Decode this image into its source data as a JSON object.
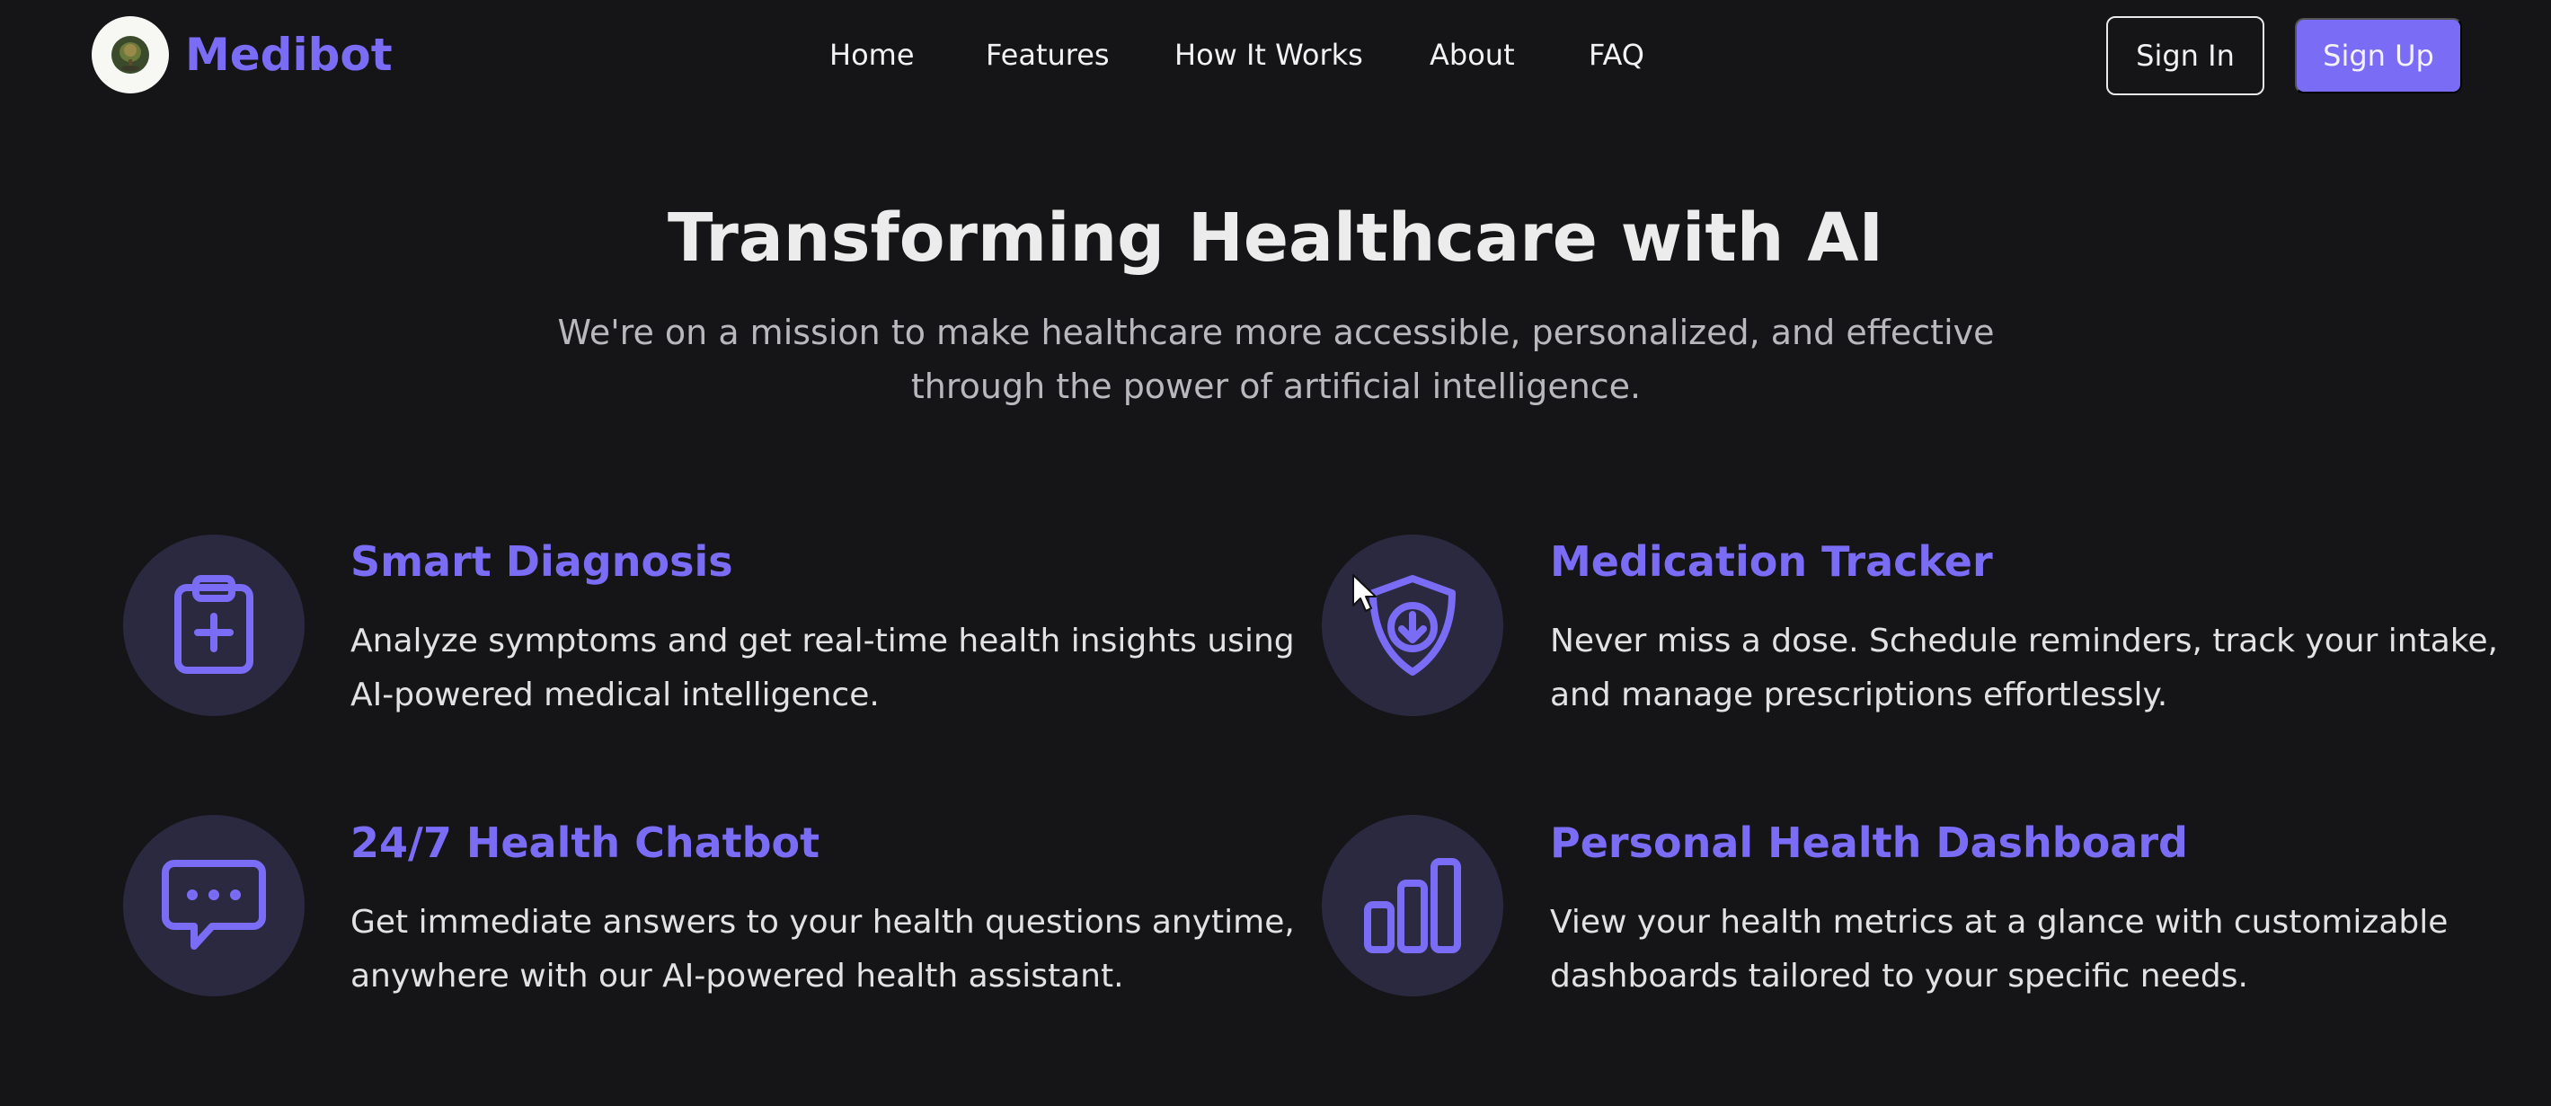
{
  "brand": {
    "name": "Medibot",
    "logo_icon": "leaf-emblem-icon"
  },
  "nav": {
    "links": [
      "Home",
      "Features",
      "How It Works",
      "About",
      "FAQ"
    ],
    "sign_in": "Sign In",
    "sign_up": "Sign Up"
  },
  "hero": {
    "title": "Transforming Healthcare with AI",
    "subtitle_line1": "We're on a mission to make healthcare more accessible, personalized, and effective",
    "subtitle_line2": "through the power of artificial intelligence."
  },
  "features": [
    {
      "title": "Smart Diagnosis",
      "desc_line1": "Analyze symptoms and get real-time health insights using",
      "desc_line2": "AI-powered medical intelligence.",
      "icon": "clipboard-plus-icon"
    },
    {
      "title": "Medication Tracker",
      "desc_line1": "Never miss a dose. Schedule reminders, track your intake,",
      "desc_line2": "and manage prescriptions effortlessly.",
      "icon": "shield-arrow-icon"
    },
    {
      "title": "24/7 Health Chatbot",
      "desc_line1": "Get immediate answers to your health questions anytime,",
      "desc_line2": "anywhere with our AI-powered health assistant.",
      "icon": "chat-bubble-icon"
    },
    {
      "title": "Personal Health Dashboard",
      "desc_line1": "View your health metrics at a glance with customizable",
      "desc_line2": "dashboards tailored to your specific needs.",
      "icon": "bar-chart-icon"
    }
  ],
  "colors": {
    "accent": "#7b6cf6",
    "background": "#151416",
    "icon_circle": "#2a2940"
  }
}
